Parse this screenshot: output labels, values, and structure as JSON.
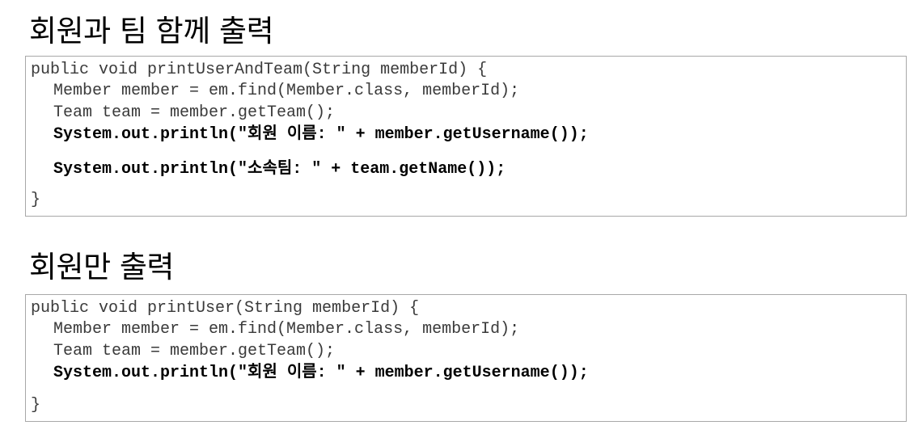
{
  "section1": {
    "title": "회원과 팀 함께 출력",
    "lines": [
      "public void printUserAndTeam(String memberId) {",
      "Member member = em.find(Member.class, memberId);",
      "Team team = member.getTeam();",
      "System.out.println(\"회원 이름: \" + member.getUsername());",
      "System.out.println(\"소속팀: \" + team.getName());",
      "}"
    ]
  },
  "section2": {
    "title": "회원만 출력",
    "lines": [
      "public void printUser(String memberId) {",
      "Member member = em.find(Member.class, memberId);",
      "Team team = member.getTeam();",
      "System.out.println(\"회원 이름: \" + member.getUsername());",
      "}"
    ]
  }
}
